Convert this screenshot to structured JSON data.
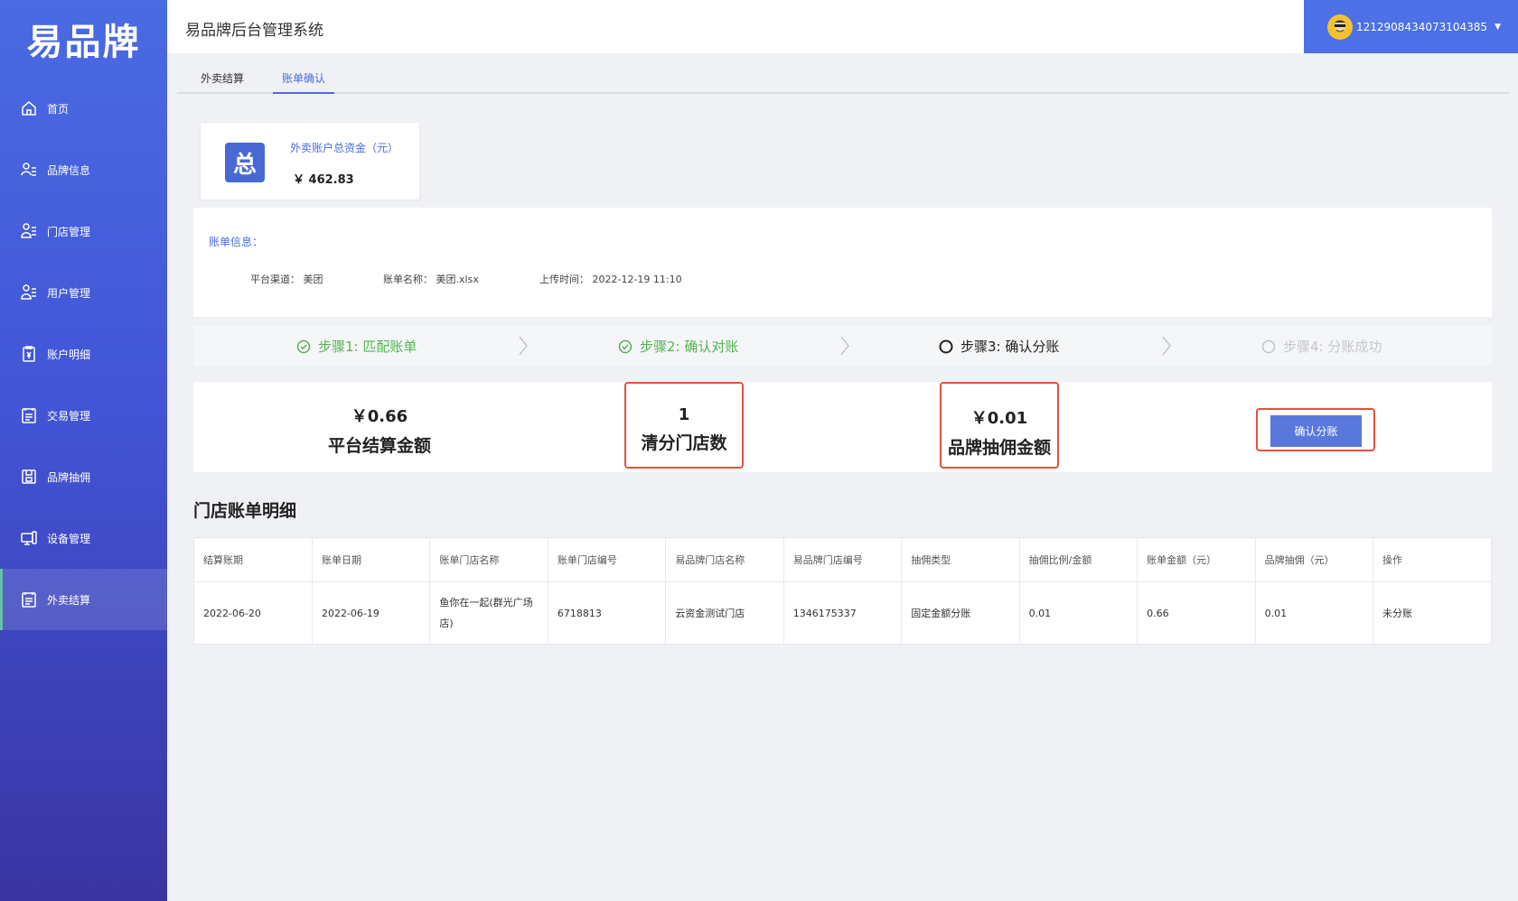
{
  "brand": {
    "logo_text": "易品牌"
  },
  "header": {
    "title": "易品牌后台管理系统",
    "username": "1212908434073104385"
  },
  "sidebar": {
    "items": [
      {
        "label": "首页",
        "icon": "home-icon"
      },
      {
        "label": "品牌信息",
        "icon": "brand-info-icon"
      },
      {
        "label": "门店管理",
        "icon": "store-icon"
      },
      {
        "label": "用户管理",
        "icon": "user-icon"
      },
      {
        "label": "账户明细",
        "icon": "account-icon"
      },
      {
        "label": "交易管理",
        "icon": "transaction-icon"
      },
      {
        "label": "品牌抽佣",
        "icon": "commission-icon"
      },
      {
        "label": "设备管理",
        "icon": "device-icon"
      },
      {
        "label": "外卖结算",
        "icon": "settlement-icon"
      }
    ],
    "active_index": 8
  },
  "tabs": [
    {
      "label": "外卖结算"
    },
    {
      "label": "账单确认"
    }
  ],
  "total_card": {
    "icon_text": "总",
    "label": "外卖账户总资金（元）",
    "value": "￥ 462.83"
  },
  "bill_info": {
    "title": "账单信息：",
    "channel_label": "平台渠道：",
    "channel_value": "美团",
    "name_label": "账单名称：",
    "name_value": "美团.xlsx",
    "time_label": "上传时间：",
    "time_value": "2022-12-19 11:10"
  },
  "steps": [
    {
      "label": "步骤1: 匹配账单",
      "status": "done"
    },
    {
      "label": "步骤2: 确认对账",
      "status": "done"
    },
    {
      "label": "步骤3: 确认分账",
      "status": "current"
    },
    {
      "label": "步骤4: 分账成功",
      "status": "pending"
    }
  ],
  "stats": {
    "platform_amount_value": "￥0.66",
    "platform_amount_label": "平台结算金额",
    "store_count_value": "1",
    "store_count_label": "清分门店数",
    "commission_value": "￥0.01",
    "commission_label": "品牌抽佣金额",
    "confirm_button": "确认分账"
  },
  "details": {
    "title": "门店账单明细",
    "columns": [
      "结算账期",
      "账单日期",
      "账单门店名称",
      "账单门店编号",
      "易品牌门店名称",
      "易品牌门店编号",
      "抽佣类型",
      "抽佣比例/金额",
      "账单金额（元）",
      "品牌抽佣（元）",
      "操作"
    ],
    "rows": [
      [
        "2022-06-20",
        "2022-06-19",
        "鱼你在一起(群光广场店)",
        "6718813",
        "云资金测试门店",
        "1346175337",
        "固定金额分账",
        "0.01",
        "0.66",
        "0.01",
        "未分账"
      ]
    ]
  },
  "colors": {
    "accent": "#4a6be2",
    "success": "#52b44f",
    "highlight": "#e2513c"
  }
}
